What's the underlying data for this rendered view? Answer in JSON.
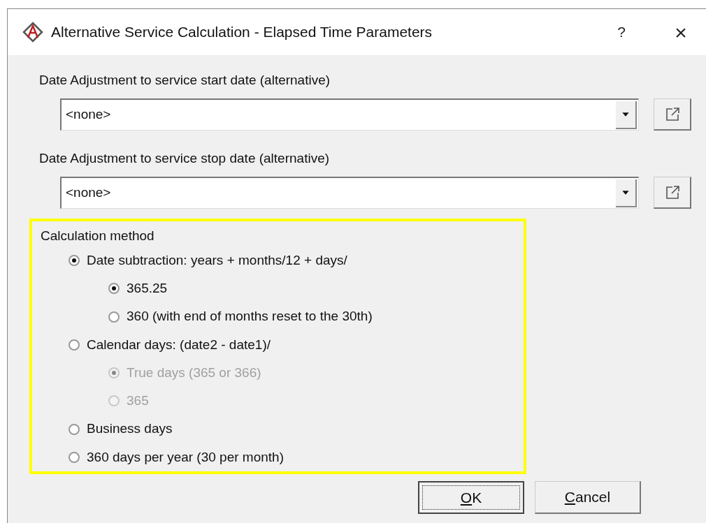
{
  "window": {
    "title": "Alternative Service Calculation - Elapsed Time Parameters",
    "help": "?",
    "close": "×"
  },
  "fields": [
    {
      "label": "Date Adjustment to service start date (alternative)",
      "value": "<none>"
    },
    {
      "label": "Date Adjustment to service stop date (alternative)",
      "value": "<none>"
    }
  ],
  "calculation_method": {
    "title": "Calculation method",
    "highlighted": true,
    "options": [
      {
        "label": "Date subtraction: years + months/12 + days/",
        "selected": true,
        "disabled": false,
        "children": [
          {
            "label": "365.25",
            "selected": true,
            "disabled": false
          },
          {
            "label": "360 (with end of months reset to the 30th)",
            "selected": false,
            "disabled": false
          }
        ]
      },
      {
        "label": "Calendar days: (date2 - date1)/",
        "selected": false,
        "disabled": false,
        "children": [
          {
            "label": "True days (365 or 366)",
            "selected": true,
            "disabled": true
          },
          {
            "label": "365",
            "selected": false,
            "disabled": true
          }
        ]
      },
      {
        "label": "Business days",
        "selected": false,
        "disabled": false
      },
      {
        "label": "360 days per year (30 per month)",
        "selected": false,
        "disabled": false
      }
    ]
  },
  "buttons": [
    {
      "mnemonic": "O",
      "rest": "K",
      "focused": true
    },
    {
      "mnemonic": "C",
      "rest": "ancel",
      "focused": false
    }
  ]
}
